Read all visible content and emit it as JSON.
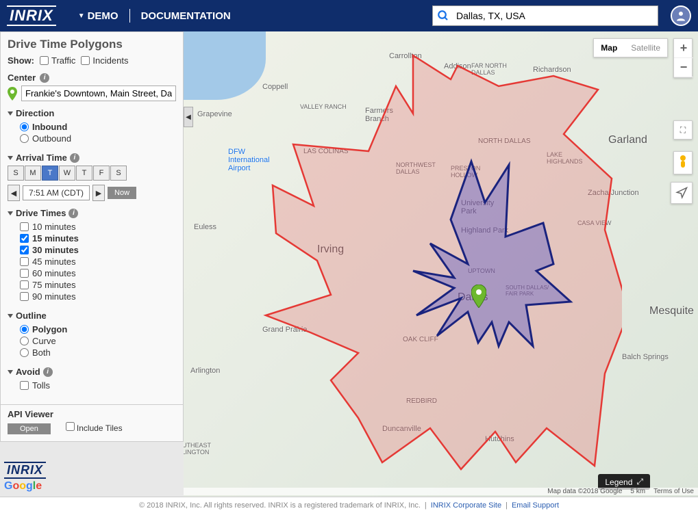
{
  "brand": "INRIX",
  "nav": {
    "demo": "DEMO",
    "documentation": "DOCUMENTATION"
  },
  "search": {
    "value": "Dallas, TX, USA"
  },
  "sidebar": {
    "title": "Drive Time Polygons",
    "show_label": "Show:",
    "show_traffic": "Traffic",
    "show_incidents": "Incidents",
    "center_label": "Center",
    "center_value": "Frankie's Downtown, Main Street, Dallas, TX, USA",
    "direction": {
      "label": "Direction",
      "inbound": "Inbound",
      "outbound": "Outbound",
      "selected": "inbound"
    },
    "arrival_time": {
      "label": "Arrival Time",
      "days": [
        "S",
        "M",
        "T",
        "W",
        "T",
        "F",
        "S"
      ],
      "active_day_index": 2,
      "time": "7:51 AM (CDT)",
      "now": "Now"
    },
    "drive_times": {
      "label": "Drive Times",
      "options": [
        {
          "label": "10 minutes",
          "checked": false
        },
        {
          "label": "15 minutes",
          "checked": true
        },
        {
          "label": "30 minutes",
          "checked": true
        },
        {
          "label": "45 minutes",
          "checked": false
        },
        {
          "label": "60 minutes",
          "checked": false
        },
        {
          "label": "75 minutes",
          "checked": false
        },
        {
          "label": "90 minutes",
          "checked": false
        }
      ]
    },
    "outline": {
      "label": "Outline",
      "polygon": "Polygon",
      "curve": "Curve",
      "both": "Both",
      "selected": "polygon"
    },
    "avoid": {
      "label": "Avoid",
      "tolls": "Tolls"
    },
    "api_viewer": {
      "label": "API Viewer",
      "open": "Open",
      "include_tiles": "Include Tiles"
    }
  },
  "map": {
    "type_map": "Map",
    "type_satellite": "Satellite",
    "legend": "Legend",
    "attribution": "Map data ©2018 Google",
    "scale": "5 km",
    "terms": "Terms of Use",
    "labels": {
      "dallas": "Dallas",
      "irving": "Irving",
      "garland": "Garland",
      "mesquite": "Mesquite",
      "carrollton": "Carrollton",
      "addison": "Addison",
      "richardson": "Richardson",
      "coppell": "Coppell",
      "grapevine": "Grapevine",
      "euless": "Euless",
      "arlington": "Arlington",
      "grand_prairie": "Grand Prairie",
      "duncanville": "Duncanville",
      "hutchins": "Hutchins",
      "balch_springs": "Balch Springs",
      "dfw": "DFW\nInternational\nAirport",
      "oak_cliff": "OAK CLIFF",
      "redbird": "REDBIRD",
      "uptown": "UPTOWN",
      "highland_park": "Highland Park",
      "university_park": "University\nPark",
      "north_dallas": "NORTH DALLAS",
      "preston_hollow": "PRESTON\nHOLLOW",
      "nw_dallas": "NORTHWEST\nDALLAS",
      "las_colinas": "LAS COLINAS",
      "farmers_branch": "Farmers\nBranch",
      "valley_ranch": "VALLEY RANCH",
      "far_north": "FAR NORTH\nDALLAS",
      "lake_highlands": "LAKE\nHIGHLANDS",
      "casa_view": "CASA VIEW",
      "zacha": "Zacha Junction",
      "south_dallas": "SOUTH DALLAS/\nFAIR PARK",
      "se_arlington": "SOUTHEAST\nARLINGTON"
    }
  },
  "footer": {
    "copyright": "© 2018 INRIX, Inc. All rights reserved. INRIX is a registered trademark of INRIX, Inc.",
    "corporate": "INRIX Corporate Site",
    "support": "Email Support",
    "google": "Google"
  }
}
